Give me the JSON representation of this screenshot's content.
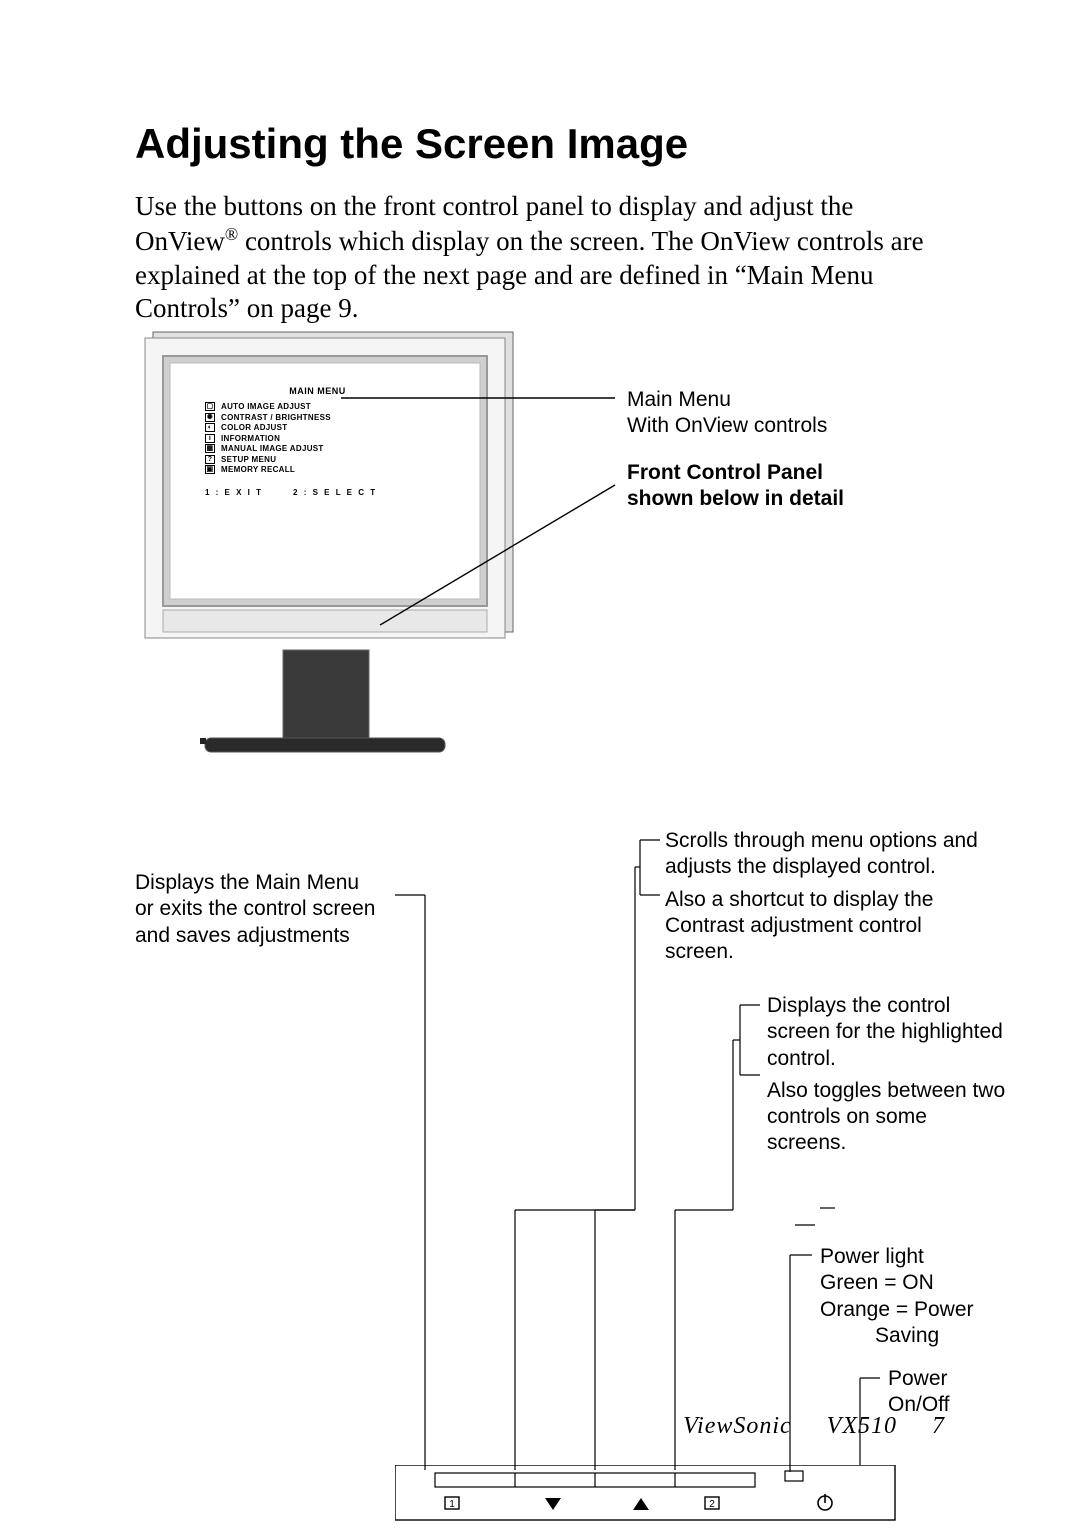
{
  "heading": "Adjusting the Screen Image",
  "intro_html": "Use the buttons on the front control panel to display and adjust the OnView® controls which display on the screen. The OnView controls are explained at the top of the next page and are defined in “Main Menu Controls” on page 9.",
  "osd": {
    "title": "MAIN MENU",
    "items": [
      "AUTO IMAGE ADJUST",
      "CONTRAST / BRIGHTNESS",
      "COLOR ADJUST",
      "INFORMATION",
      "MANUAL IMAGE ADJUST",
      "SETUP MENU",
      "MEMORY RECALL"
    ],
    "footer_left": "1 : E X I T",
    "footer_right": "2 : S E L E C T"
  },
  "callouts": {
    "main_menu_line1": "Main Menu",
    "main_menu_line2": "With OnView controls",
    "fcp_line1": "Front Control Panel",
    "fcp_line2": "shown below in detail",
    "button1_line1": "Displays the Main Menu",
    "button1_line2": "or exits the control screen",
    "button1_line3": "and saves adjustments",
    "arrows_line1": "Scrolls through menu options and",
    "arrows_line2": "adjusts the displayed control.",
    "arrows_line3": "Also a shortcut to display the",
    "arrows_line4": "Contrast adjustment control",
    "arrows_line5": "screen.",
    "button2_line1": "Displays the control",
    "button2_line2": "screen for the highlighted",
    "button2_line3": "control.",
    "button2_line4": "Also toggles between two",
    "button2_line5": "controls on some",
    "button2_line6": "screens.",
    "powerlight_line1": "Power light",
    "powerlight_line2": "Green = ON",
    "powerlight_line3": "Orange = Power",
    "powerlight_line4": "Saving",
    "power_line1": "Power",
    "power_line2": "On/Off"
  },
  "footer": {
    "brand": "ViewSonic",
    "model": "VX510",
    "page": "7"
  },
  "panel_buttons": {
    "b1": "1",
    "b2": "2"
  }
}
